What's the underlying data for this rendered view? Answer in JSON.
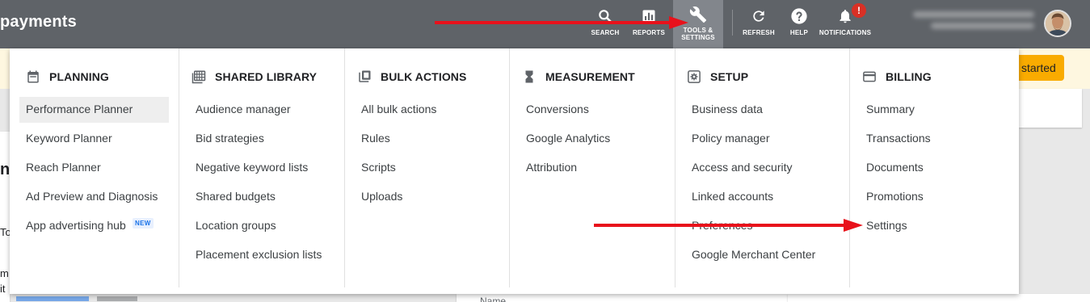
{
  "app": {
    "title": "payments"
  },
  "toolbar": {
    "items": [
      {
        "label": "SEARCH",
        "icon": "search-icon"
      },
      {
        "label": "REPORTS",
        "icon": "reports-icon"
      },
      {
        "label": "TOOLS &\nSETTINGS",
        "icon": "wrench-icon",
        "active": true
      },
      {
        "label": "REFRESH",
        "icon": "refresh-icon"
      },
      {
        "label": "HELP",
        "icon": "help-icon"
      },
      {
        "label": "NOTIFICATIONS",
        "icon": "bell-icon",
        "badge": "!"
      }
    ]
  },
  "page": {
    "get_started_label": "started",
    "left_fragments": [
      "nt",
      "To",
      "m",
      "it"
    ],
    "column_fragment": "Name"
  },
  "menu": {
    "columns": [
      {
        "heading": "PLANNING",
        "icon": "calendar-icon",
        "items": [
          {
            "label": "Performance Planner",
            "selected": true
          },
          {
            "label": "Keyword Planner"
          },
          {
            "label": "Reach Planner"
          },
          {
            "label": "Ad Preview and Diagnosis"
          },
          {
            "label": "App advertising hub",
            "badge": "NEW"
          }
        ]
      },
      {
        "heading": "SHARED LIBRARY",
        "icon": "library-icon",
        "items": [
          {
            "label": "Audience manager"
          },
          {
            "label": "Bid strategies"
          },
          {
            "label": "Negative keyword lists"
          },
          {
            "label": "Shared budgets"
          },
          {
            "label": "Location groups"
          },
          {
            "label": "Placement exclusion lists"
          }
        ]
      },
      {
        "heading": "BULK ACTIONS",
        "icon": "copy-icon",
        "items": [
          {
            "label": "All bulk actions"
          },
          {
            "label": "Rules"
          },
          {
            "label": "Scripts"
          },
          {
            "label": "Uploads"
          }
        ]
      },
      {
        "heading": "MEASUREMENT",
        "icon": "hourglass-icon",
        "items": [
          {
            "label": "Conversions"
          },
          {
            "label": "Google Analytics"
          },
          {
            "label": "Attribution"
          }
        ]
      },
      {
        "heading": "SETUP",
        "icon": "settings-box-icon",
        "items": [
          {
            "label": "Business data"
          },
          {
            "label": "Policy manager"
          },
          {
            "label": "Access and security"
          },
          {
            "label": "Linked accounts"
          },
          {
            "label": "Preferences"
          },
          {
            "label": "Google Merchant Center"
          }
        ]
      },
      {
        "heading": "BILLING",
        "icon": "credit-card-icon",
        "items": [
          {
            "label": "Summary"
          },
          {
            "label": "Transactions"
          },
          {
            "label": "Documents"
          },
          {
            "label": "Promotions"
          },
          {
            "label": "Settings"
          }
        ]
      }
    ]
  },
  "colors": {
    "topbar": "#5f6368",
    "annotation_arrow": "#e8111b",
    "new_badge": "#1a73e8",
    "get_started": "#f9ab00"
  }
}
